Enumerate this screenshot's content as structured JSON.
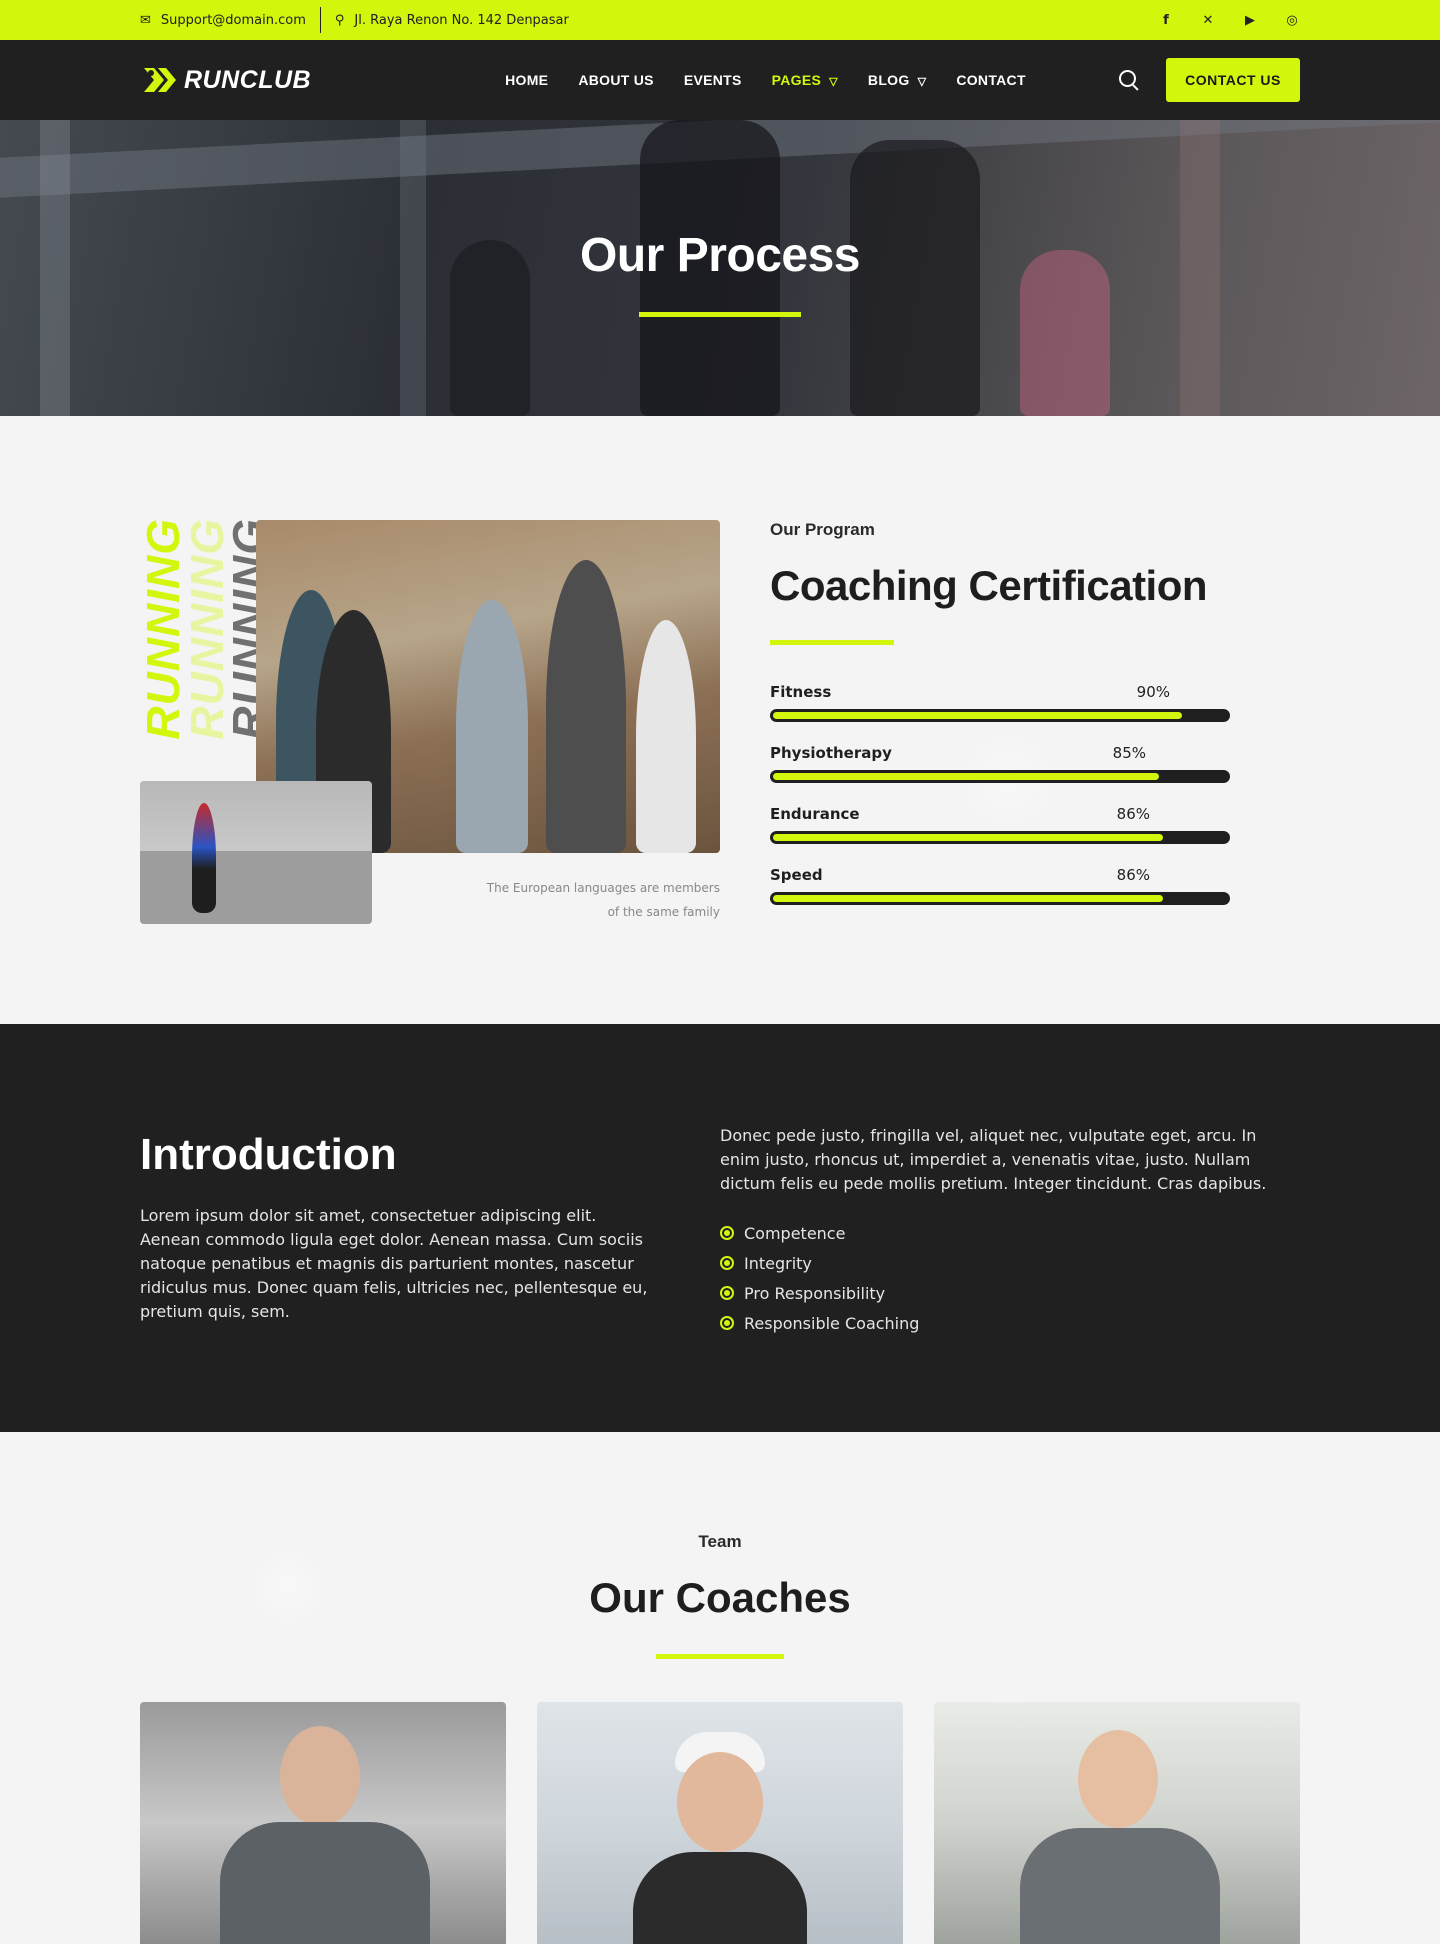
{
  "topbar": {
    "email": "Support@domain.com",
    "address": "Jl. Raya Renon No. 142 Denpasar",
    "social": [
      "facebook-icon",
      "x-icon",
      "youtube-icon",
      "instagram-icon"
    ]
  },
  "nav": {
    "brand": "RUNCLUB",
    "items": [
      "HOME",
      "ABOUT US",
      "EVENTS",
      "PAGES",
      "BLOG",
      "CONTACT"
    ],
    "active": "PAGES",
    "cta": "CONTACT US"
  },
  "hero": {
    "title": "Our Process"
  },
  "program": {
    "vertical_text": "RUNNING",
    "caption_line1": "The European languages are members",
    "caption_line2": "of the same family",
    "eyebrow": "Our Program",
    "title": "Coaching Certification",
    "skills": [
      {
        "name": "Fitness",
        "value": 90,
        "label": "90%"
      },
      {
        "name": "Physiotherapy",
        "value": 85,
        "label": "85%"
      },
      {
        "name": "Endurance",
        "value": 86,
        "label": "86%"
      },
      {
        "name": "Speed",
        "value": 86,
        "label": "86%"
      }
    ]
  },
  "intro": {
    "title": "Introduction",
    "left_text": "Lorem ipsum dolor sit amet, consectetuer adipiscing elit. Aenean commodo ligula eget dolor. Aenean massa. Cum sociis natoque penatibus et magnis dis parturient montes, nascetur ridiculus mus. Donec quam felis, ultricies nec, pellentesque eu, pretium quis, sem.",
    "right_text": "Donec pede justo, fringilla vel, aliquet nec, vulputate eget, arcu. In enim justo, rhoncus ut, imperdiet a, venenatis vitae, justo. Nullam dictum felis eu pede mollis pretium. Integer tincidunt. Cras dapibus.",
    "checklist": [
      "Competence",
      "Integrity",
      "Pro Responsibility",
      "Responsible Coaching"
    ]
  },
  "team": {
    "eyebrow": "Team",
    "title": "Our Coaches"
  },
  "colors": {
    "accent": "#d4f50c",
    "dark": "#202020"
  }
}
